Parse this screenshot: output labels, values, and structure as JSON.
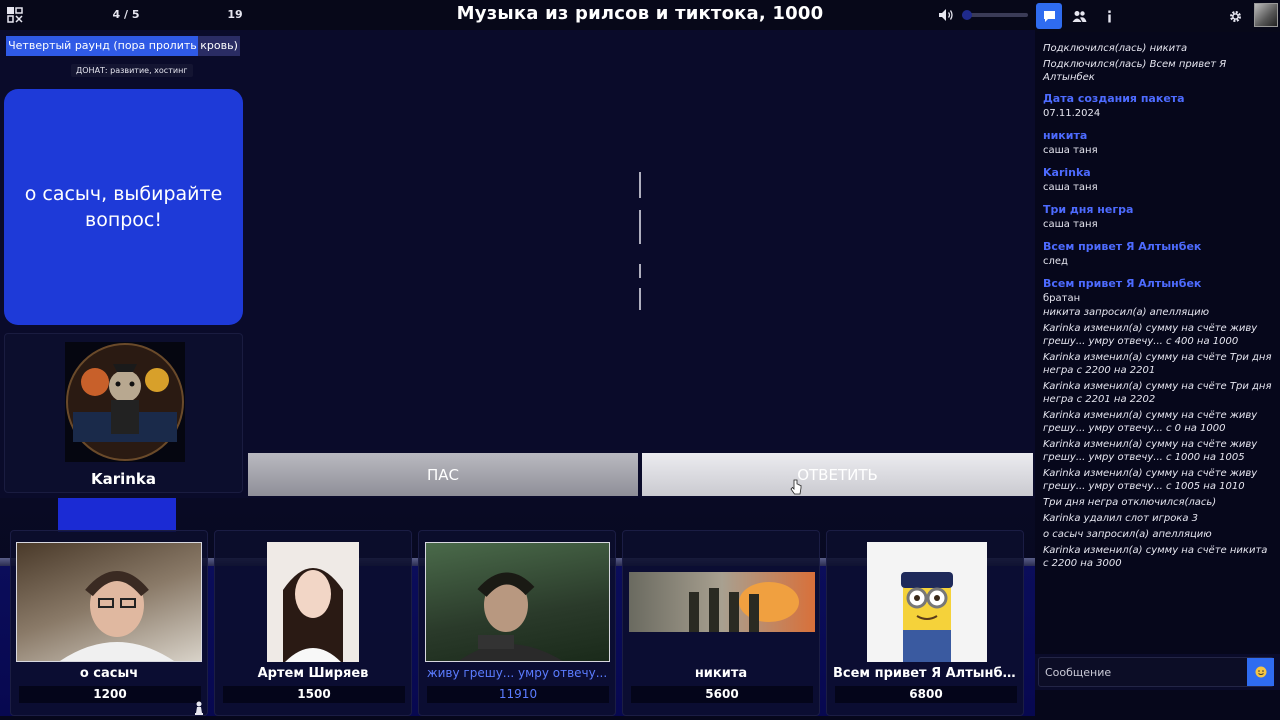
{
  "header": {
    "round_counter": "4 / 5",
    "questions_left": "19",
    "pack_title": "Музыка из рилсов и тиктока, 1000"
  },
  "left": {
    "round_name": "Четвертый раунд (пора пролить кровь)",
    "round_progress": 0.82,
    "donate_label": "ДОНАТ: развитие, хостинг",
    "message": "о сасыч, выбирайте вопрос!",
    "host_name": "Karinka"
  },
  "actions": {
    "pass_label": "ПАС",
    "answer_label": "ОТВЕТИТЬ"
  },
  "players": [
    {
      "name": "о сасыч",
      "score": "1200",
      "active": false
    },
    {
      "name": "Артем Ширяев",
      "score": "1500",
      "active": false
    },
    {
      "name": "живу грешу... умру отвечу...",
      "score": "11910",
      "active": true
    },
    {
      "name": "никита",
      "score": "5600",
      "active": false
    },
    {
      "name": "Всем привет Я Алтынбек",
      "score": "6800",
      "active": false
    }
  ],
  "chat": {
    "top_lines": [
      "Подключился(лась) никита",
      "Подключился(лась) Всем привет Я Алтынбек"
    ],
    "messages": [
      {
        "author": "Дата создания пакета",
        "text": "07.11.2024"
      },
      {
        "author": "никита",
        "text": "саша таня"
      },
      {
        "author": "Karinka",
        "text": "саша таня"
      },
      {
        "author": "Три дня негра",
        "text": "саша таня"
      },
      {
        "author": "Всем привет Я Алтынбек",
        "text": "след"
      },
      {
        "author": "Всем привет Я Алтынбек",
        "text": "братан"
      }
    ],
    "system_lines": [
      "никита запросил(а) апелляцию",
      "Karinka изменил(а) сумму на счёте живу грешу... умру отвечу... с 400 на 1000",
      "Karinka изменил(а) сумму на счёте Три дня негра с 2200 на 2201",
      "Karinka изменил(а) сумму на счёте Три дня негра с 2201 на 2202",
      "Karinka изменил(а) сумму на счёте живу грешу... умру отвечу... с 0 на 1000",
      "Karinka изменил(а) сумму на счёте живу грешу... умру отвечу... с 1000 на 1005",
      "Karinka изменил(а) сумму на счёте живу грешу... умру отвечу... с 1005 на 1010",
      "Три дня негра отключился(лась)",
      "Karinka удалил слот игрока 3",
      "о сасыч запросил(а) апелляцию",
      "Karinka изменил(а) сумму на счёте никита с 2200 на 3000"
    ],
    "input_placeholder": "Сообщение"
  },
  "colors": {
    "accent": "#2f6cf0",
    "card": "#1e3ad8",
    "author": "#4d6bff",
    "active_player": "#5b7cff"
  }
}
